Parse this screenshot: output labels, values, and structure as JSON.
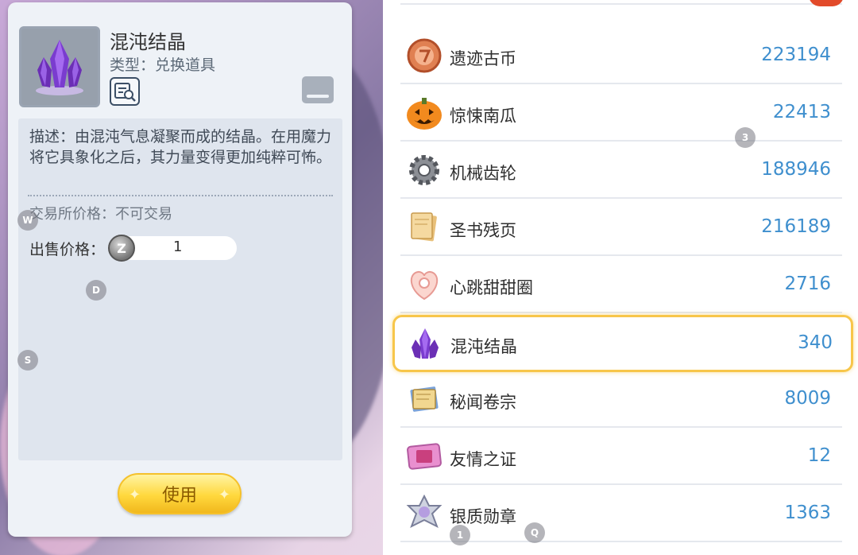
{
  "detail": {
    "name": "混沌结晶",
    "type": "类型：兑换道具",
    "description": "描述：由混沌气息凝聚而成的结晶。在用魔力将它具象化之后，其力量变得更加纯粹可怖。",
    "trade_price": "交易所价格：不可交易",
    "sell_label": "出售价格：",
    "sell_value": "1",
    "coin_symbol": "Z",
    "use_label": "使用"
  },
  "hints": {
    "w": "W",
    "d": "D",
    "s": "S",
    "three": "3",
    "one": "1",
    "q": "Q"
  },
  "list": {
    "items": [
      {
        "name": "遗迹古币",
        "count": "223194",
        "icon": "relic-coin-icon"
      },
      {
        "name": "惊悚南瓜",
        "count": "22413",
        "icon": "pumpkin-icon"
      },
      {
        "name": "机械齿轮",
        "count": "188946",
        "icon": "gear-icon"
      },
      {
        "name": "圣书残页",
        "count": "216189",
        "icon": "scroll-page-icon"
      },
      {
        "name": "心跳甜甜圈",
        "count": "2716",
        "icon": "donut-icon"
      },
      {
        "name": "混沌结晶",
        "count": "340",
        "icon": "chaos-crystal-icon",
        "selected": true
      },
      {
        "name": "秘闻卷宗",
        "count": "8009",
        "icon": "dossier-icon"
      },
      {
        "name": "友情之证",
        "count": "12",
        "icon": "friendship-card-icon"
      },
      {
        "name": "银质勋章",
        "count": "1363",
        "icon": "silver-medal-icon"
      }
    ]
  },
  "colors": {
    "accent": "#3f8fce",
    "selected_border": "#f7c64a",
    "button": "#ffd83d"
  }
}
